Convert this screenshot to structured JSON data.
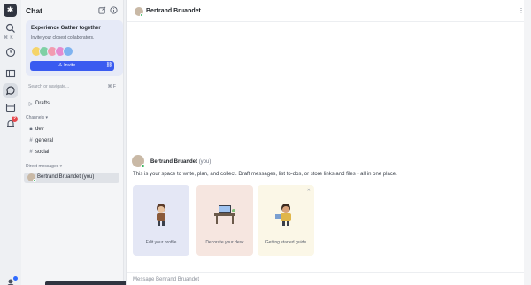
{
  "rail": {
    "logo_glyph": "✱",
    "shortcut": "⌘ K",
    "notification_count": "2",
    "icons": [
      "search-icon",
      "clock-icon",
      "map-icon",
      "chat-icon",
      "calendar-icon",
      "bell-icon",
      "avatar-icon"
    ]
  },
  "sidebar": {
    "title": "Chat",
    "promo": {
      "title": "Experience Gather together",
      "subtitle": "Invite your closest collaborators.",
      "invite_label": "Invite",
      "avatar_colors": [
        "#f5d46a",
        "#7fd0a6",
        "#f29bb0",
        "#e58bd0",
        "#7fb3f0"
      ]
    },
    "search": {
      "placeholder": "Search or navigate...",
      "shortcut": "⌘ F"
    },
    "drafts_label": "Drafts",
    "channels_label": "Channels",
    "channels": [
      {
        "label": "dev",
        "icon": "lock-icon"
      },
      {
        "label": "general",
        "icon": "hash-icon"
      },
      {
        "label": "social",
        "icon": "hash-icon"
      }
    ],
    "dm_label": "Direct messages",
    "dms": [
      {
        "label": "Bertrand Bruandet (you)"
      }
    ]
  },
  "main": {
    "header_name": "Bertrand Bruandet",
    "message": {
      "author": "Bertrand Bruandet",
      "author_suffix": "(you)",
      "description": "This is your space to write, plan, and collect. Draft messages, list to-dos, or store links and files - all in one place."
    },
    "cards": [
      {
        "label": "Edit your profile",
        "bg": "#e4e7f5"
      },
      {
        "label": "Decorate your desk",
        "bg": "#f6e6e0"
      },
      {
        "label": "Getting started guide",
        "bg": "#fbf7e7"
      }
    ],
    "composer_placeholder": "Message Bertrand Bruandet"
  },
  "colors": {
    "accent": "#3a5bf0",
    "online": "#2fb35a",
    "badge": "#e5484d"
  }
}
